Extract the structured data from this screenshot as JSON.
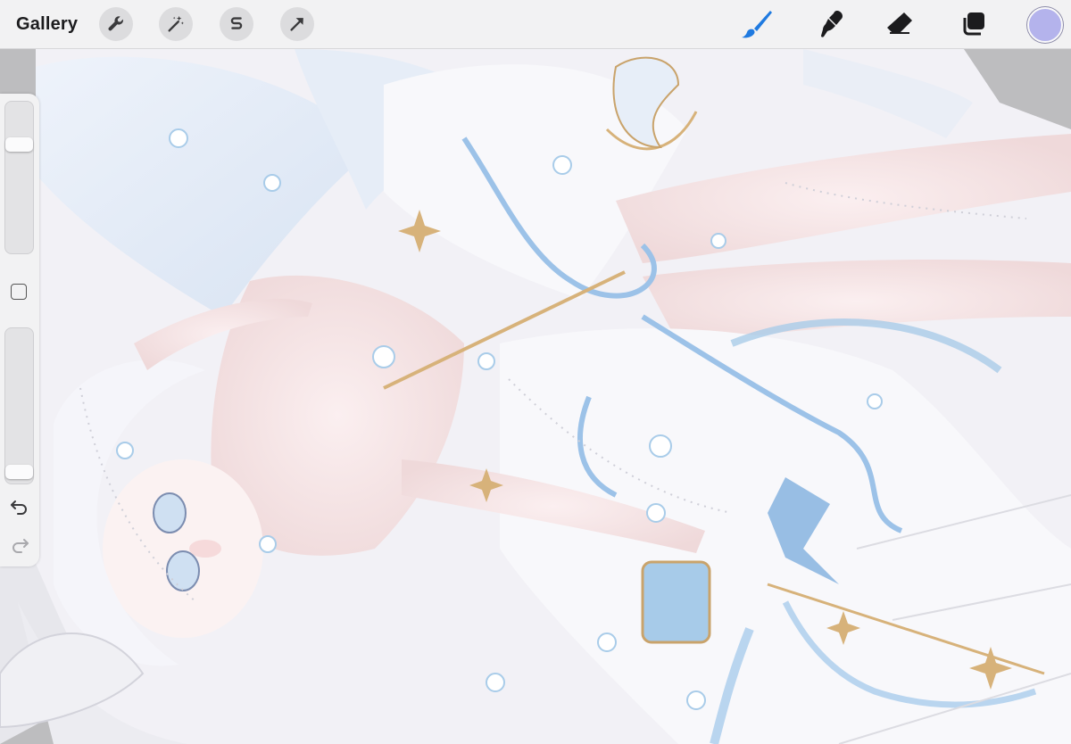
{
  "toolbar": {
    "gallery_label": "Gallery",
    "left_tools": [
      "wrench-icon",
      "magic-wand-icon",
      "selection-s-icon",
      "transform-arrow-icon"
    ],
    "right_tools": [
      "brush-icon",
      "smudge-icon",
      "eraser-icon",
      "layers-icon"
    ],
    "active_tool": "brush-icon",
    "active_color": "#b4b3ec",
    "accent_color": "#1f7ae0"
  },
  "sidebar": {
    "brush_size_level": 0.74,
    "opacity_level": 0.03,
    "items": [
      "brush-size-slider",
      "modify-button",
      "opacity-slider",
      "undo-icon",
      "redo-icon"
    ]
  },
  "canvas": {
    "background_color": "#bdbdbf",
    "artwork_palette": [
      "#f4f3f8",
      "#9cc2e8",
      "#d7b27a",
      "#f3dcdc",
      "#c9d8ee"
    ]
  }
}
